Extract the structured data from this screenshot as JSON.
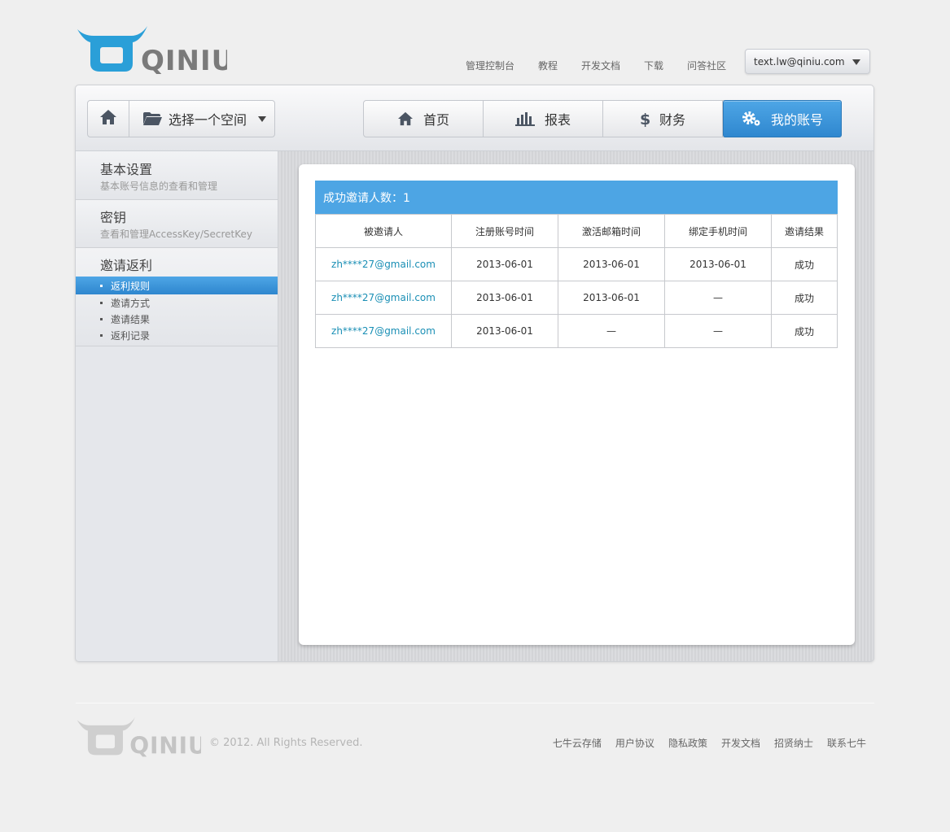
{
  "brand": {
    "name": "QINIU"
  },
  "top_nav": [
    {
      "label": "管理控制台"
    },
    {
      "label": "教程"
    },
    {
      "label": "开发文档"
    },
    {
      "label": "下载"
    },
    {
      "label": "问答社区"
    }
  ],
  "account": {
    "email": "text.lw@qiniu.com"
  },
  "toolbar": {
    "space_select_label": "选择一个空间",
    "tabs": [
      {
        "label": "首页",
        "icon": "home-icon"
      },
      {
        "label": "报表",
        "icon": "bar-chart-icon"
      },
      {
        "label": "财务",
        "icon": "dollar-icon"
      },
      {
        "label": "我的账号",
        "icon": "gears-icon",
        "active": true
      }
    ]
  },
  "sidebar": {
    "sections": [
      {
        "title": "基本设置",
        "subtitle": "基本账号信息的查看和管理"
      },
      {
        "title": "密钥",
        "subtitle": "查看和管理AccessKey/SecretKey"
      },
      {
        "title": "邀请返利",
        "items": [
          {
            "label": "返利规则",
            "active": true
          },
          {
            "label": "邀请方式"
          },
          {
            "label": "邀请结果"
          },
          {
            "label": "返利记录"
          }
        ]
      }
    ]
  },
  "invites": {
    "heading": "成功邀请人数：1",
    "columns": [
      "被邀请人",
      "注册账号时间",
      "激活邮箱时间",
      "绑定手机时间",
      "邀请结果"
    ],
    "rows": [
      [
        "zh****27@gmail.com",
        "2013-06-01",
        "2013-06-01",
        "2013-06-01",
        "成功"
      ],
      [
        "zh****27@gmail.com",
        "2013-06-01",
        "2013-06-01",
        "—",
        "成功"
      ],
      [
        "zh****27@gmail.com",
        "2013-06-01",
        "—",
        "—",
        "成功"
      ]
    ]
  },
  "footer": {
    "copyright": "© 2012. All Rights Reserved.",
    "links": [
      {
        "label": "七牛云存储"
      },
      {
        "label": "用户协议"
      },
      {
        "label": "隐私政策"
      },
      {
        "label": "开发文档"
      },
      {
        "label": "招贤纳士"
      },
      {
        "label": "联系七牛"
      }
    ]
  },
  "colors": {
    "accent": "#2f87cf",
    "header_bar": "#4da5e4",
    "link": "#1a8fb5"
  }
}
